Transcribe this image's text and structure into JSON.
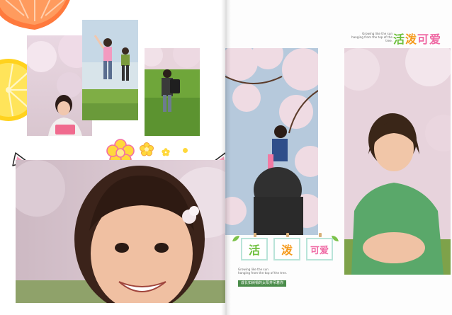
{
  "right_header": {
    "caption_line1": "Growing like the sun",
    "caption_line2": "hanging from the top of the tree.",
    "title_char1": "活",
    "title_char2": "泼",
    "title_char3": "可爱"
  },
  "tiles": {
    "tile1": "活",
    "tile2": "泼",
    "tile3": "可爱"
  },
  "bottom_caption": {
    "line1": "Growing like the sun",
    "line2": "hanging from the top of the tree.",
    "ribbon_text": "成长如树梢的太阳并吊着你"
  },
  "colors": {
    "title_green": "#6dbf3b",
    "title_orange": "#f59a1b",
    "title_pink": "#ef6aa4",
    "tile_border": "#b9e4d9",
    "ribbon_green": "#4a8c4a",
    "flower_yellow": "#ffd83b",
    "flower_pink": "#f26fa4"
  },
  "icons": {
    "orange_slice_top": "orange-slice-icon",
    "lemon_slice": "lemon-slice-icon",
    "flower_big": "flower-icon",
    "cat_ear_left": "cat-ear-icon",
    "cat_ear_right": "cat-ear-icon"
  }
}
